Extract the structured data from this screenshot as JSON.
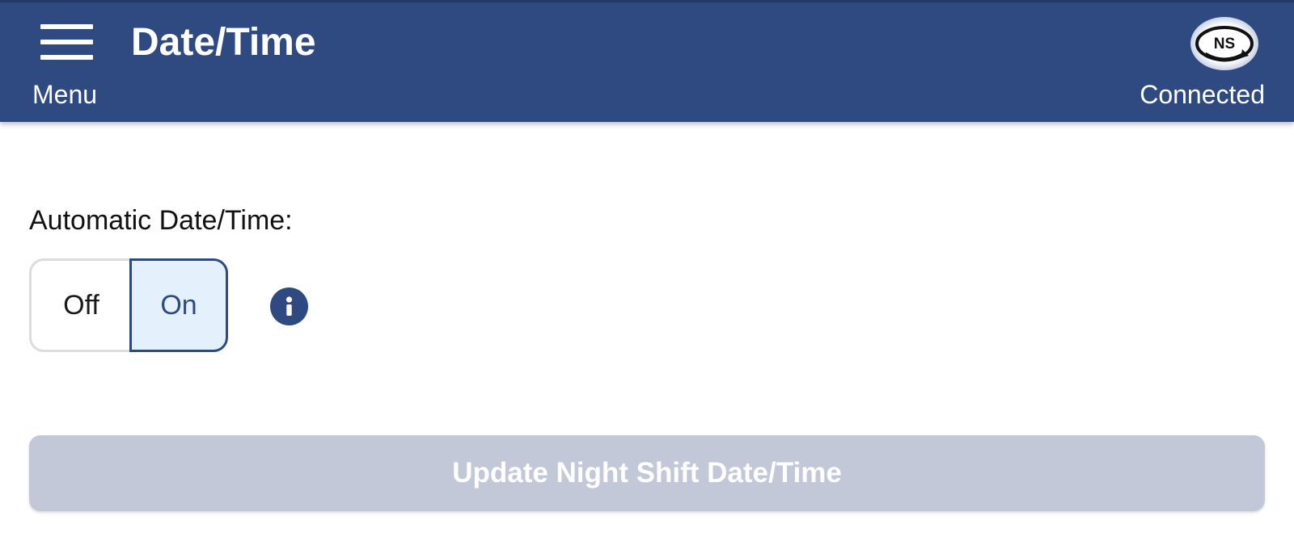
{
  "header": {
    "menu_label": "Menu",
    "title": "Date/Time",
    "status_label": "Connected",
    "logo_text": "NS",
    "menu_icon": "hamburger-icon",
    "logo_icon": "ns-logo-icon"
  },
  "content": {
    "setting_label": "Automatic Date/Time:",
    "toggle": {
      "off_label": "Off",
      "on_label": "On",
      "selected": "On"
    },
    "info_icon": "info-icon",
    "update_button_label": "Update Night Shift Date/Time",
    "update_button_enabled": false
  },
  "colors": {
    "header_bg": "#2e4a80",
    "toggle_selected_bg": "#e4f1fc",
    "disabled_button_bg": "#c2c8d8"
  }
}
